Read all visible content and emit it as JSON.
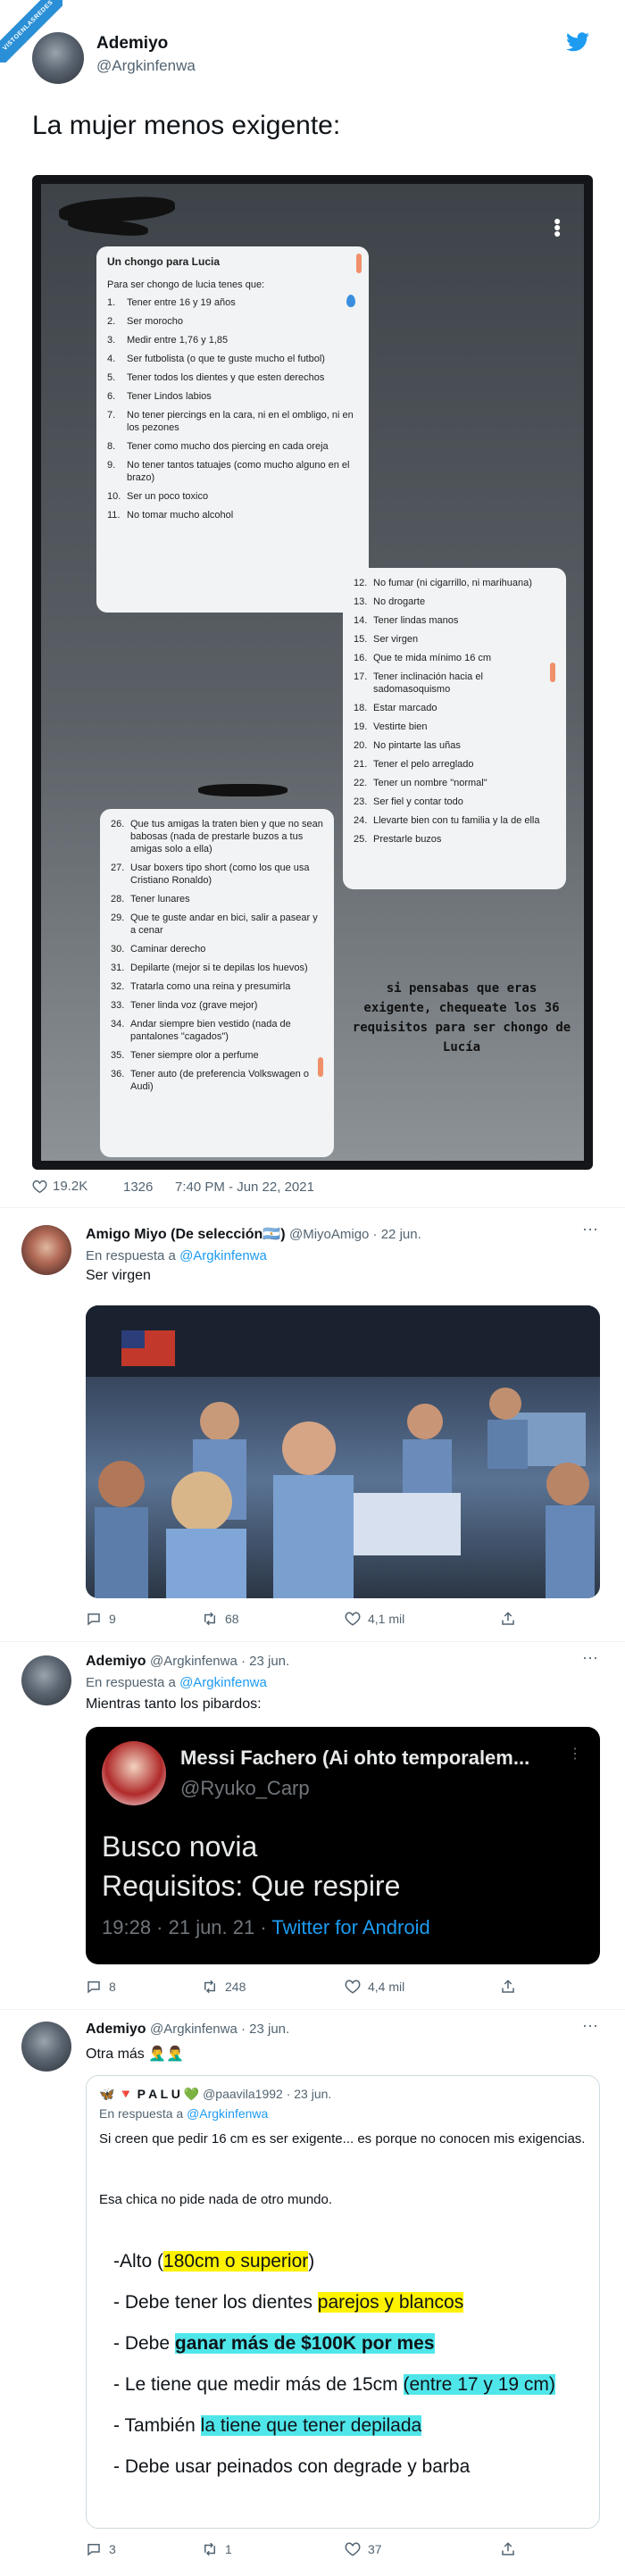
{
  "banner": {
    "text": "VISTOENLASREDES"
  },
  "header": {
    "name": "Ademiyo",
    "handle": "@Argkinfenwa"
  },
  "main_tweet": {
    "text": "La mujer menos exigente:",
    "screenshot": {
      "panel1": {
        "title": "Un chongo para Lucia",
        "intro": "Para ser chongo de lucia tenes que:",
        "items": [
          {
            "n": "1.",
            "t": "Tener entre 16 y 19 años"
          },
          {
            "n": "2.",
            "t": "Ser morocho"
          },
          {
            "n": "3.",
            "t": "Medir entre 1,76 y 1,85"
          },
          {
            "n": "4.",
            "t": "Ser futbolista (o que te guste mucho el futbol)"
          },
          {
            "n": "5.",
            "t": "Tener todos los dientes y que esten derechos"
          },
          {
            "n": "6.",
            "t": "Tener Lindos labios"
          },
          {
            "n": "7.",
            "t": "No tener piercings en la cara, ni en el ombligo, ni en los pezones"
          },
          {
            "n": "8.",
            "t": "Tener como mucho dos piercing en cada oreja"
          },
          {
            "n": "9.",
            "t": "No tener tantos tatuajes (como mucho alguno en el brazo)"
          },
          {
            "n": "10.",
            "t": "Ser un poco toxico"
          },
          {
            "n": "11.",
            "t": "No tomar mucho alcohol"
          }
        ]
      },
      "panel2": {
        "items": [
          {
            "n": "12.",
            "t": "No fumar (ni cigarrillo, ni marihuana)"
          },
          {
            "n": "13.",
            "t": "No drogarte"
          },
          {
            "n": "14.",
            "t": "Tener lindas manos"
          },
          {
            "n": "15.",
            "t": "Ser virgen"
          },
          {
            "n": "16.",
            "t": "Que te mida mínimo 16 cm"
          },
          {
            "n": "17.",
            "t": "Tener inclinación hacia el sadomasoquismo"
          },
          {
            "n": "18.",
            "t": "Estar marcado"
          },
          {
            "n": "19.",
            "t": "Vestirte bien"
          },
          {
            "n": "20.",
            "t": "No pintarte las uñas"
          },
          {
            "n": "21.",
            "t": "Tener el pelo arreglado"
          },
          {
            "n": "22.",
            "t": "Tener un nombre \"normal\""
          },
          {
            "n": "23.",
            "t": "Ser fiel y contar todo"
          },
          {
            "n": "24.",
            "t": "Llevarte bien con tu familia y la de ella"
          },
          {
            "n": "25.",
            "t": "Prestarle buzos"
          }
        ]
      },
      "panel3": {
        "items": [
          {
            "n": "26.",
            "t": "Que tus amigas la traten bien y que no sean babosas (nada de prestarle buzos a tus amigas solo a ella)"
          },
          {
            "n": "27.",
            "t": "Usar boxers tipo short (como los que usa Cristiano Ronaldo)"
          },
          {
            "n": "28.",
            "t": "Tener lunares"
          },
          {
            "n": "29.",
            "t": "Que te guste andar en bici, salir a pasear y a cenar"
          },
          {
            "n": "30.",
            "t": "Caminar derecho"
          },
          {
            "n": "31.",
            "t": "Depilarte (mejor si te depilas los huevos)"
          },
          {
            "n": "32.",
            "t": "Tratarla como una reina y presumirla"
          },
          {
            "n": "33.",
            "t": "Tener linda voz (grave mejor)"
          },
          {
            "n": "34.",
            "t": "Andar siempre bien vestido (nada de pantalones \"cagados\")"
          },
          {
            "n": "35.",
            "t": "Tener siempre olor a perfume"
          },
          {
            "n": "36.",
            "t": "Tener auto (de preferencia Volkswagen o Audi)"
          }
        ]
      },
      "overlay": "si pensabas que eras exigente, chequeate los 36 requisitos para ser chongo de Lucía"
    },
    "likes": "19.2K",
    "retweets": "1326",
    "time": "7:40 PM - Jun 22, 2021"
  },
  "replies": [
    {
      "name": "Amigo Miyo (De selección🇦🇷)",
      "handle": "@MiyoAmigo · 22 jun.",
      "reply_to_label": "En respuesta a",
      "reply_to": "@Argkinfenwa",
      "text": "Ser virgen",
      "comments": "9",
      "retweets": "68",
      "likes": "4,1 mil"
    },
    {
      "name": "Ademiyo",
      "handle": "@Argkinfenwa · 23 jun.",
      "reply_to_label": "En respuesta a",
      "reply_to": "@Argkinfenwa",
      "text": "Mientras tanto los pibardos:",
      "embed": {
        "name": "Messi Fachero (Ai ohto temporalem...",
        "handle": "@Ryuko_Carp",
        "line1": "Busco novia",
        "line2": "Requisitos: Que respire",
        "time": "19:28 · 21 jun. 21 · ",
        "source": "Twitter for Android"
      },
      "comments": "8",
      "retweets": "248",
      "likes": "4,4 mil"
    },
    {
      "name": "Ademiyo",
      "handle": "@Argkinfenwa · 23 jun.",
      "text": "Otra más 🤦‍♂️🤦‍♂️",
      "quote": {
        "name": "🦋 🔻 P A L U 💚",
        "handle": "@paavila1992 · 23 jun.",
        "reply_to_label": "En respuesta a",
        "reply_to": "@Argkinfenwa",
        "text1": "Si creen que pedir 16 cm es ser exigente... es porque no conocen mis exigencias.",
        "text2": "Esa chica no pide nada de otro mundo.",
        "lines": [
          {
            "pre": "-Alto (",
            "hl": "180cm o  superior",
            "post": ")",
            "color": "y"
          },
          {
            "pre": "- Debe tener los dientes ",
            "hl": "parejos y blancos",
            "post": "",
            "color": "y"
          },
          {
            "pre": "- Debe ",
            "hl": "ganar más de $100K por mes",
            "post": "",
            "color": "c"
          },
          {
            "pre": "- Le tiene que medir más de 15cm ",
            "hl": "(entre 17 y 19 cm)",
            "post": "",
            "color": "c"
          },
          {
            "pre": "- También ",
            "hl": "la tiene que tener depilada",
            "post": "",
            "color": "c"
          },
          {
            "pre": "- Debe usar peinados con degrade y barba",
            "hl": "",
            "post": "",
            "color": ""
          }
        ]
      },
      "comments": "3",
      "retweets": "1",
      "likes": "37"
    }
  ]
}
